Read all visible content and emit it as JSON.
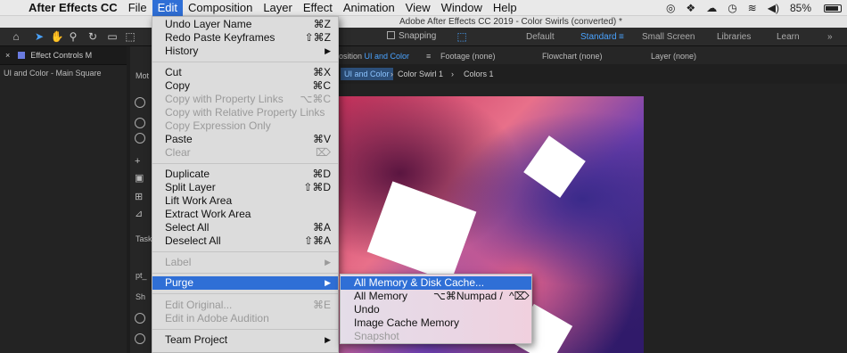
{
  "menubar": {
    "app_name": "After Effects CC",
    "items": [
      "File",
      "Edit",
      "Composition",
      "Layer",
      "Effect",
      "Animation",
      "View",
      "Window",
      "Help"
    ],
    "active_item": "Edit",
    "battery_percent": "85%"
  },
  "window_title": "Adobe After Effects CC 2019 - Color Swirls (converted) *",
  "toolbar": {
    "snapping_label": "Snapping",
    "workspaces": [
      "Default",
      "Standard",
      "Small Screen",
      "Libraries",
      "Learn"
    ],
    "active_workspace": "Standard"
  },
  "left_panel": {
    "tab_label": "Effect Controls M",
    "subtitle": "UI and Color - Main Square",
    "partial_labels": [
      "Mot",
      "Task",
      "pt_",
      "Sh"
    ]
  },
  "comp_tabs": {
    "composition_prefix": "osition",
    "composition_name": "UI and Color",
    "footage": "Footage (none)",
    "flowchart": "Flowchart (none)",
    "layer": "Layer (none)"
  },
  "comp_crumbs": [
    "UI and Color",
    "Color Swirl 1",
    "Colors 1"
  ],
  "edit_menu": {
    "items": [
      {
        "label": "Undo Layer Name",
        "shortcut": "⌘Z",
        "disabled": false
      },
      {
        "label": "Redo Paste Keyframes",
        "shortcut": "⇧⌘Z",
        "disabled": false
      },
      {
        "label": "History",
        "shortcut": "▶",
        "disabled": false
      },
      {
        "label": "Cut",
        "shortcut": "⌘X",
        "disabled": false
      },
      {
        "label": "Copy",
        "shortcut": "⌘C",
        "disabled": false
      },
      {
        "label": "Copy with Property Links",
        "shortcut": "⌥⌘C",
        "disabled": true
      },
      {
        "label": "Copy with Relative Property Links",
        "shortcut": "",
        "disabled": true
      },
      {
        "label": "Copy Expression Only",
        "shortcut": "",
        "disabled": true
      },
      {
        "label": "Paste",
        "shortcut": "⌘V",
        "disabled": false
      },
      {
        "label": "Clear",
        "shortcut": "⌦",
        "disabled": true
      },
      {
        "label": "Duplicate",
        "shortcut": "⌘D",
        "disabled": false
      },
      {
        "label": "Split Layer",
        "shortcut": "⇧⌘D",
        "disabled": false
      },
      {
        "label": "Lift Work Area",
        "shortcut": "",
        "disabled": false
      },
      {
        "label": "Extract Work Area",
        "shortcut": "",
        "disabled": false
      },
      {
        "label": "Select All",
        "shortcut": "⌘A",
        "disabled": false
      },
      {
        "label": "Deselect All",
        "shortcut": "⇧⌘A",
        "disabled": false
      },
      {
        "label": "Label",
        "shortcut": "▶",
        "disabled": true
      },
      {
        "label": "Purge",
        "shortcut": "▶",
        "disabled": false,
        "highlighted": true
      },
      {
        "label": "Edit Original...",
        "shortcut": "⌘E",
        "disabled": true
      },
      {
        "label": "Edit in Adobe Audition",
        "shortcut": "",
        "disabled": true
      },
      {
        "label": "Team Project",
        "shortcut": "▶",
        "disabled": false
      }
    ]
  },
  "purge_submenu": {
    "items": [
      {
        "label": "All Memory & Disk Cache...",
        "shortcut": "",
        "highlighted": true
      },
      {
        "label": "All Memory",
        "shortcut": "⌥⌘Numpad /",
        "disabled": false
      },
      {
        "label": "Undo",
        "shortcut": "",
        "disabled": false
      },
      {
        "label": "Image Cache Memory",
        "shortcut": "",
        "disabled": false
      },
      {
        "label": "Snapshot",
        "shortcut": "",
        "disabled": true
      }
    ]
  },
  "colors": {
    "highlight": "#2f6fd6",
    "workspace_active": "#4aa3ff"
  }
}
